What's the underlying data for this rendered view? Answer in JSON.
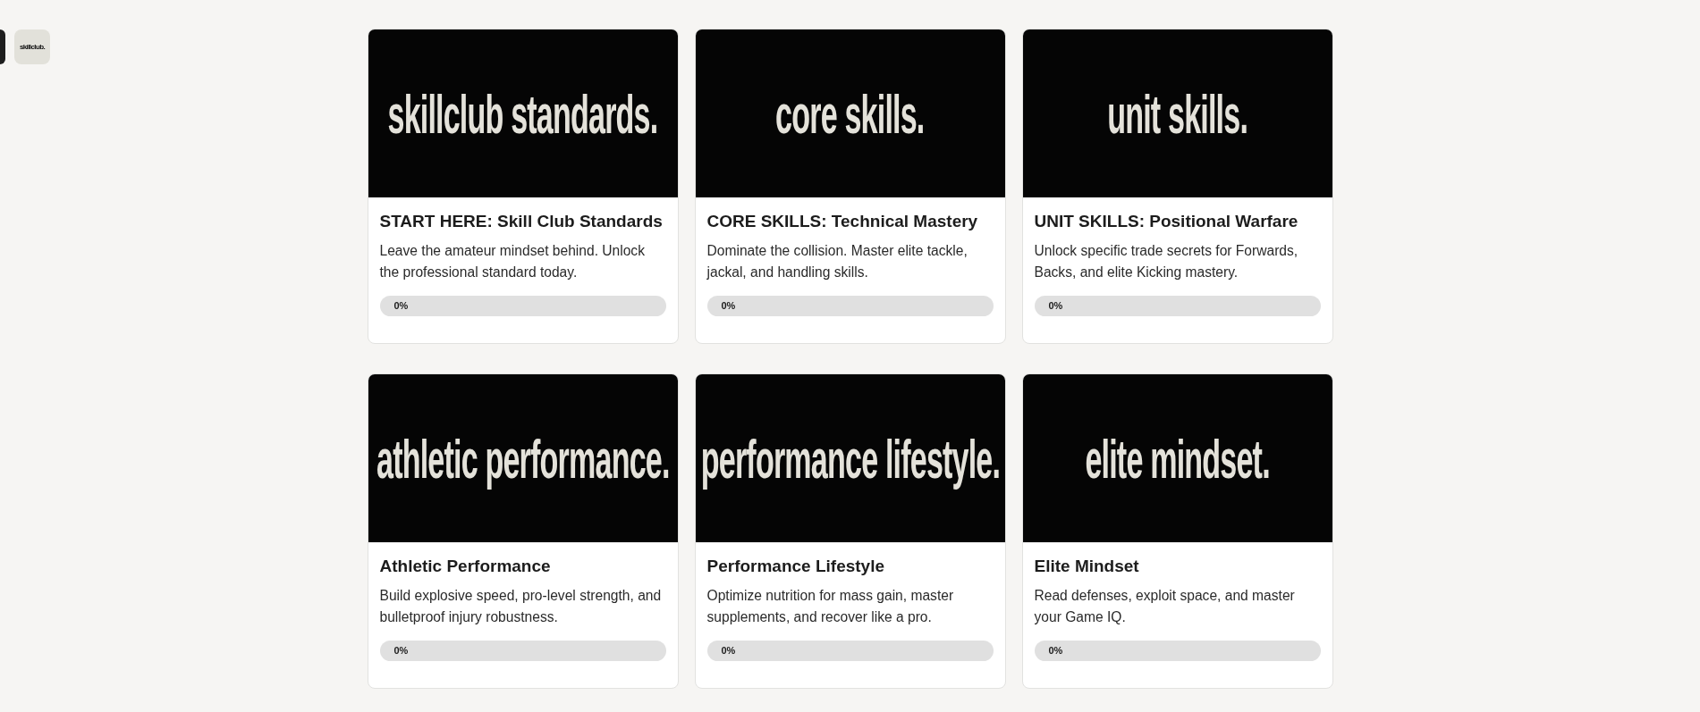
{
  "sidebar": {
    "logo_text": "skillclub."
  },
  "courses": [
    {
      "banner_text": "skillclub standards.",
      "title": "START HERE: Skill Club Standards",
      "description": "Leave the amateur mindset behind. Unlock the professional standard today.",
      "level": 0,
      "progress_label": "0%"
    },
    {
      "banner_text": "core skills.",
      "title": "CORE SKILLS: Technical Mastery",
      "description": "Dominate the collision. Master elite tackle, jackal, and handling skills.",
      "level": 0,
      "progress_label": "0%"
    },
    {
      "banner_text": "unit skills.",
      "title": "UNIT SKILLS: Positional Warfare",
      "description": "Unlock specific trade secrets for Forwards, Backs, and elite Kicking mastery.",
      "level": 0,
      "progress_label": "0%"
    },
    {
      "banner_text": "athletic performance.",
      "title": "Athletic Performance",
      "description": "Build explosive speed, pro-level strength, and bulletproof injury robustness.",
      "level": 0,
      "progress_label": "0%"
    },
    {
      "banner_text": "performance lifestyle.",
      "title": "Performance Lifestyle",
      "description": "Optimize nutrition for mass gain, master supplements, and recover like a pro.",
      "level": 0,
      "progress_label": "0%"
    },
    {
      "banner_text": "elite mindset.",
      "title": "Elite Mindset",
      "description": "Read defenses, exploit space, and master your Game IQ.",
      "level": 0,
      "progress_label": "0%"
    }
  ]
}
